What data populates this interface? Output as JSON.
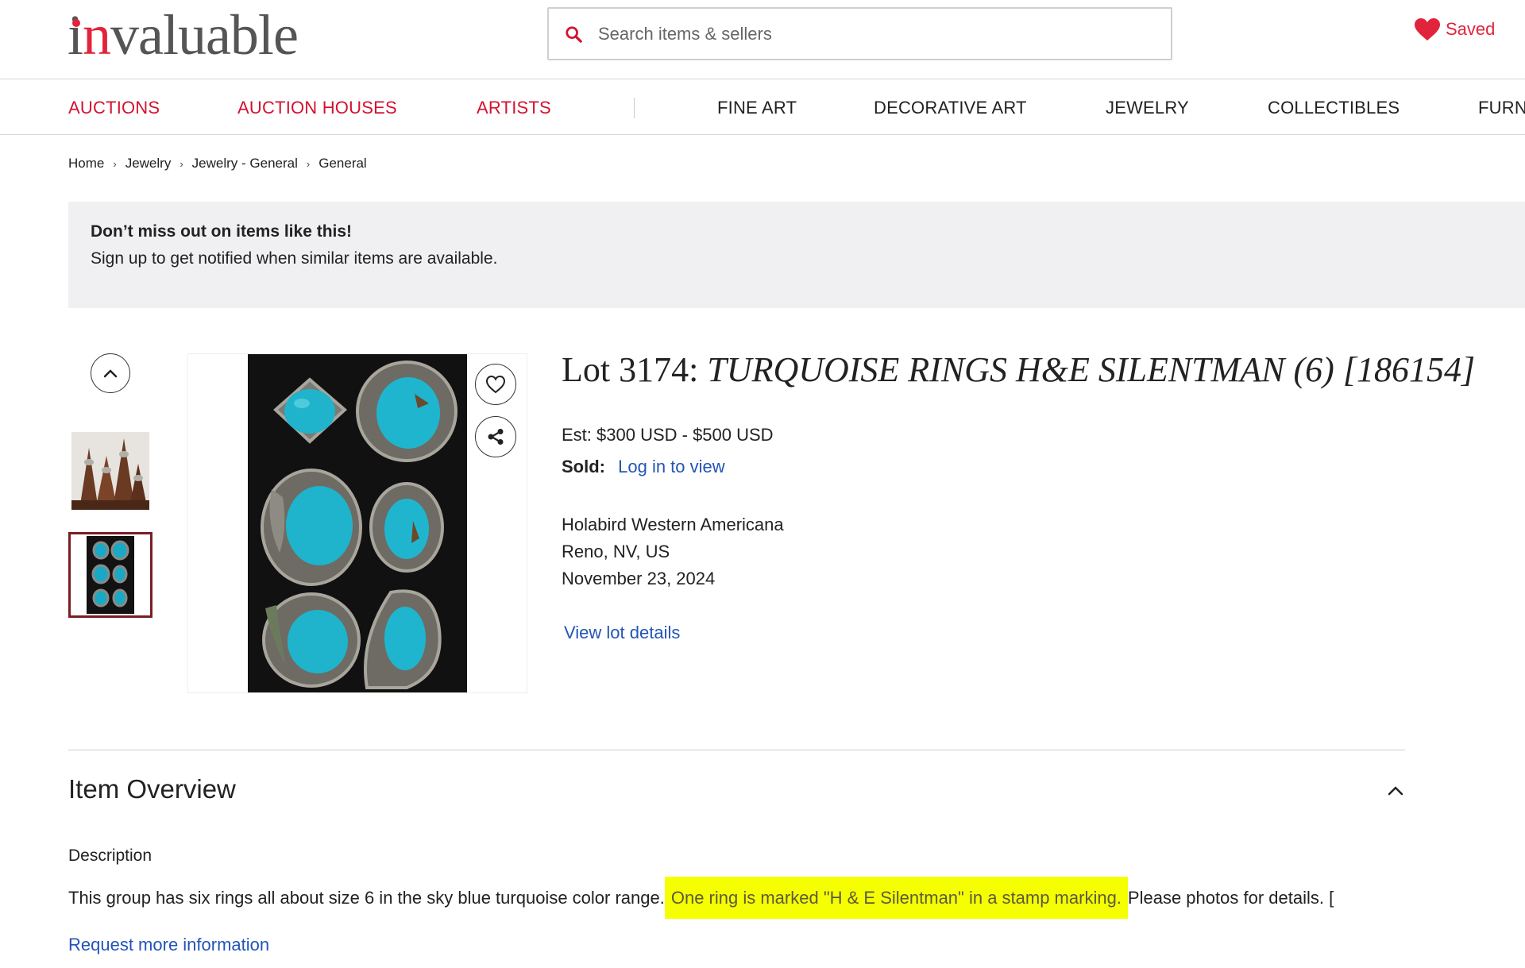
{
  "header": {
    "logo": "invaluable",
    "search_placeholder": "Search items & sellers",
    "saved_label": "Saved"
  },
  "nav": {
    "primary": [
      "AUCTIONS",
      "AUCTION HOUSES",
      "ARTISTS"
    ],
    "categories": [
      "FINE ART",
      "DECORATIVE ART",
      "JEWELRY",
      "COLLECTIBLES",
      "FURN"
    ]
  },
  "breadcrumb": [
    "Home",
    "Jewelry",
    "Jewelry - General",
    "General"
  ],
  "banner": {
    "title": "Don’t miss out on items like this!",
    "subtitle": "Sign up to get notified when similar items are available."
  },
  "lot": {
    "number_prefix": "Lot 3174:",
    "name": "TURQUOISE RINGS H&E SILENTMAN (6) [186154]",
    "estimate": "Est: $300 USD - $500 USD",
    "sold_label": "Sold:",
    "sold_link": "Log in to view",
    "auction_house": "Holabird Western Americana",
    "location": "Reno, NV, US",
    "date": "November 23, 2024",
    "view_details": "View lot details"
  },
  "overview": {
    "title": "Item Overview",
    "description_label": "Description",
    "description_before": "This group has six rings all about size 6 in the sky blue turquoise color range.",
    "description_highlight": "One ring is marked \"H & E Silentman\" in a stamp marking.",
    "description_after": "Please photos for details. [",
    "request_info": "Request more information"
  },
  "colors": {
    "brand_red": "#e1243b",
    "link_blue": "#2354b8",
    "highlight_yellow": "#f6ff00",
    "banner_gray": "#f0f0f2",
    "turquoise": "#1aa9c4"
  }
}
